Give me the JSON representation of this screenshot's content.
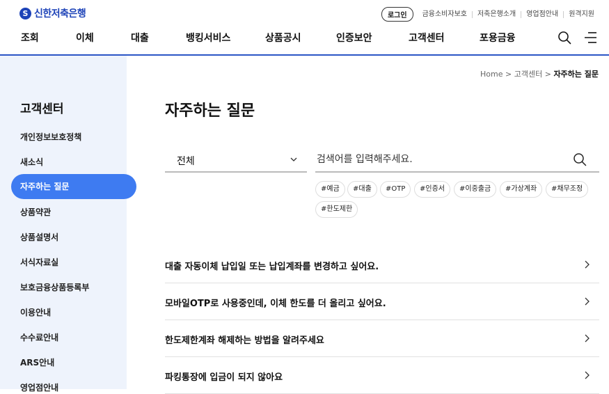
{
  "brand": {
    "name": "신한저축은행",
    "mark": "S",
    "color": "#1d43b8"
  },
  "util": {
    "login": "로그인",
    "links": [
      "금융소비자보호",
      "저축은행소개",
      "영업점안내",
      "원격지원"
    ]
  },
  "gnb": [
    "조회",
    "이체",
    "대출",
    "뱅킹서비스",
    "상품공시",
    "인증보안",
    "고객센터",
    "포용금융"
  ],
  "icons": {
    "search": "search-icon",
    "menu": "menu-icon",
    "chevron": "chevron-right-icon"
  },
  "sidebar": {
    "title": "고객센터",
    "items": [
      "개인정보보호정책",
      "새소식",
      "자주하는 질문",
      "상품약관",
      "상품설명서",
      "서식자료실",
      "보호금융상품등록부",
      "이용안내",
      "수수료안내",
      "ARS안내",
      "영업점안내"
    ],
    "active_index": 2,
    "active_color": "#3e7bf1"
  },
  "breadcrumb": {
    "home": "Home",
    "sep": ">",
    "parent": "고객센터",
    "current": "자주하는 질문"
  },
  "page": {
    "title": "자주하는 질문"
  },
  "filter": {
    "selected": "전체"
  },
  "search": {
    "placeholder": "검색어를 입력해주세요."
  },
  "tags": [
    "#예금",
    "#대출",
    "#OTP",
    "#인증서",
    "#이중출금",
    "#가상계좌",
    "#채무조정",
    "#한도제한"
  ],
  "faqs": [
    "대출 자동이체 납입일 또는 납입계좌를 변경하고 싶어요.",
    "모바일OTP로 사용중인데, 이체 한도를 더 올리고 싶어요.",
    "한도제한계좌 해제하는 방법을 알려주세요",
    "파킹통장에 입금이 되지 않아요"
  ]
}
